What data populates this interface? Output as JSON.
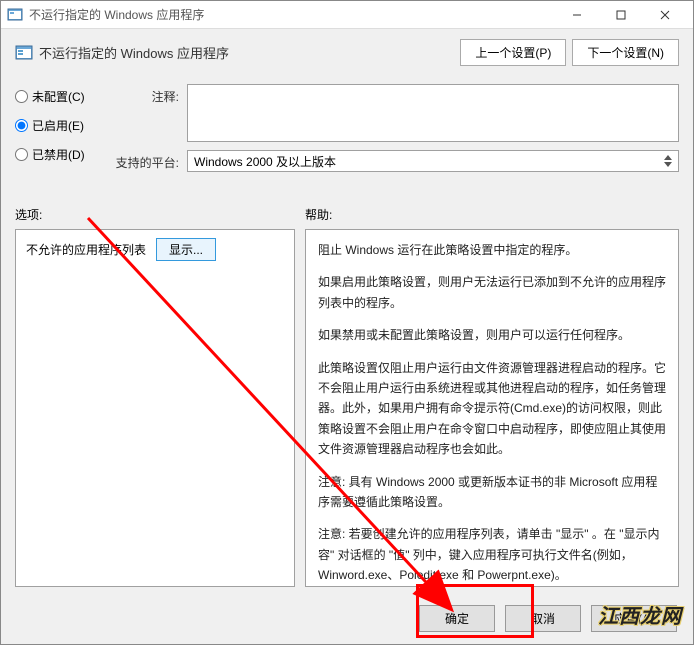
{
  "titlebar": {
    "title": "不运行指定的 Windows 应用程序"
  },
  "header": {
    "title": "不运行指定的 Windows 应用程序",
    "prev_btn": "上一个设置(P)",
    "next_btn": "下一个设置(N)"
  },
  "radio": {
    "not_configured": "未配置(C)",
    "enabled": "已启用(E)",
    "disabled": "已禁用(D)",
    "selected": "enabled"
  },
  "fields": {
    "comment_label": "注释:",
    "comment_value": "",
    "platform_label": "支持的平台:",
    "platform_value": "Windows 2000 及以上版本"
  },
  "sections": {
    "options_label": "选项:",
    "help_label": "帮助:"
  },
  "options": {
    "list_label": "不允许的应用程序列表",
    "show_btn": "显示..."
  },
  "help": {
    "p1": "阻止 Windows 运行在此策略设置中指定的程序。",
    "p2": "如果启用此策略设置，则用户无法运行已添加到不允许的应用程序列表中的程序。",
    "p3": "如果禁用或未配置此策略设置，则用户可以运行任何程序。",
    "p4": "此策略设置仅阻止用户运行由文件资源管理器进程启动的程序。它不会阻止用户运行由系统进程或其他进程启动的程序，如任务管理器。此外，如果用户拥有命令提示符(Cmd.exe)的访问权限，则此策略设置不会阻止用户在命令窗口中启动程序，即使应阻止其使用文件资源管理器启动程序也会如此。",
    "p5": "注意: 具有 Windows 2000 或更新版本证书的非 Microsoft 应用程序需要遵循此策略设置。",
    "p6": "注意: 若要创建允许的应用程序列表，请单击 \"显示\" 。在 \"显示内容\" 对话框的 \"值\" 列中，键入应用程序可执行文件名(例如，Winword.exe、Poledit.exe 和 Powerpnt.exe)。"
  },
  "buttons": {
    "ok": "确定",
    "cancel": "取消",
    "apply": "应用(A)"
  },
  "watermark": "江西龙网"
}
